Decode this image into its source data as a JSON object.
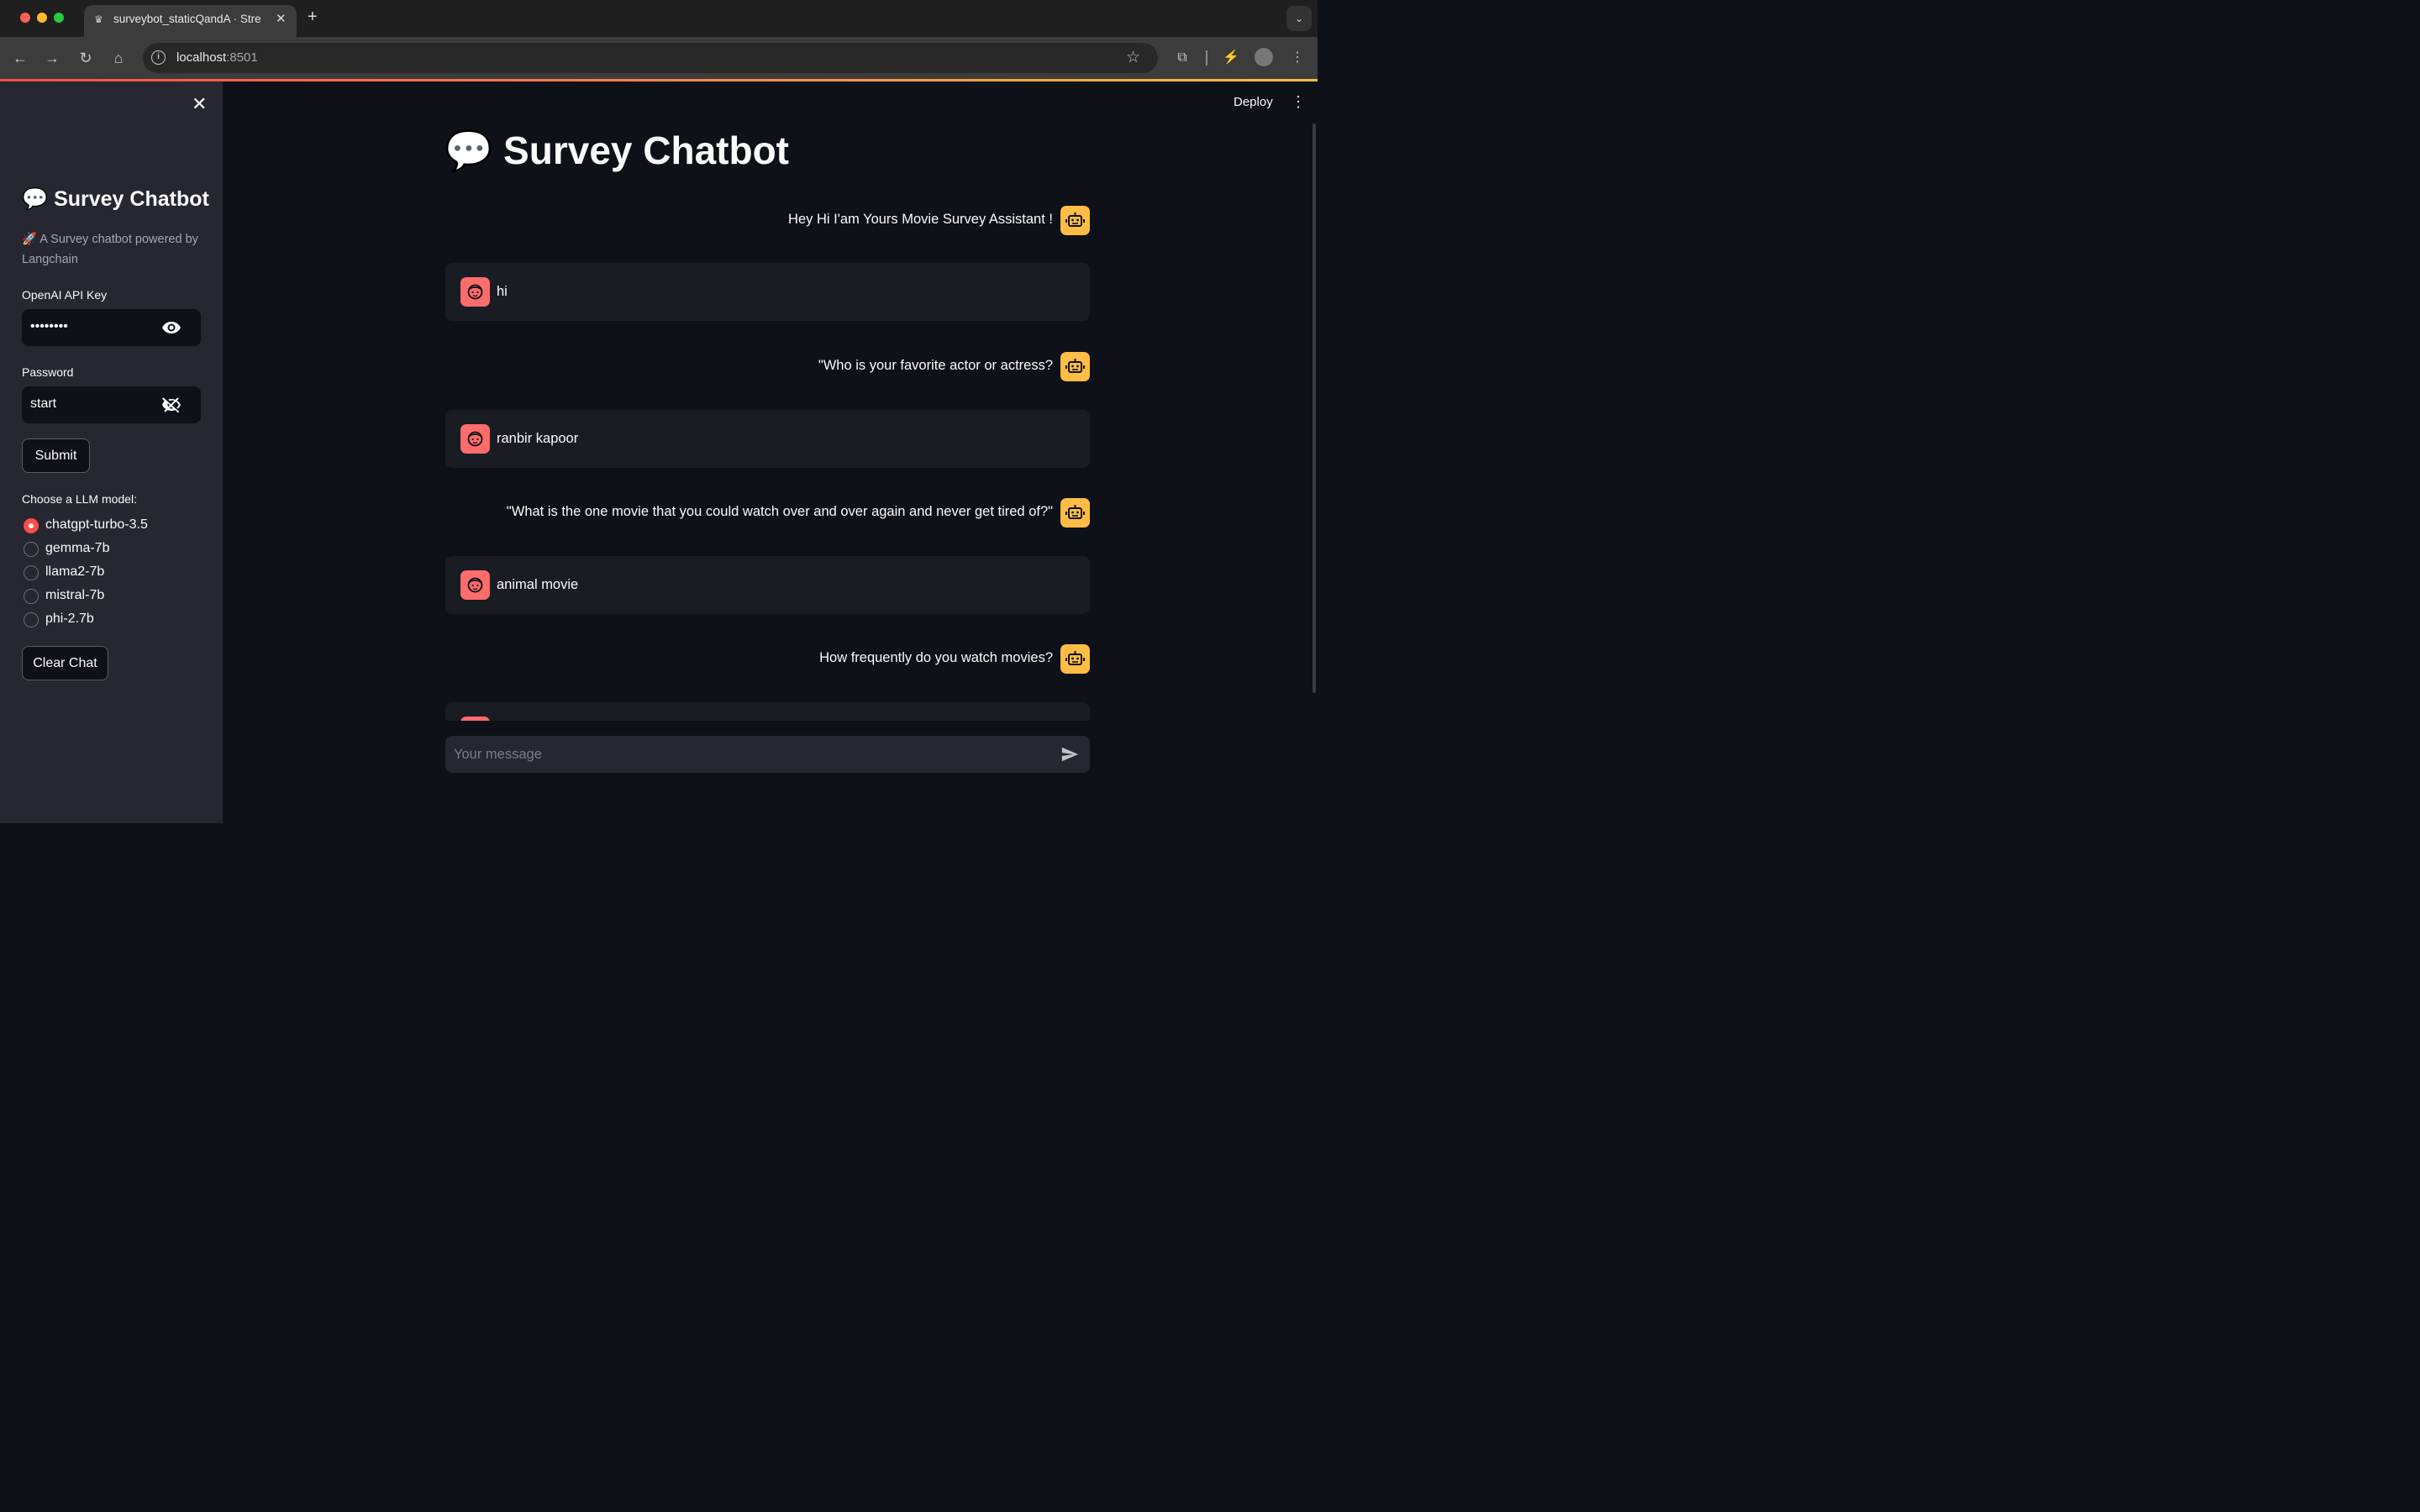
{
  "browser": {
    "tab_title": "surveybot_staticQandA · Stre",
    "url_host": "localhost",
    "url_port": ":8501"
  },
  "sidebar": {
    "title": "💬 Survey Chatbot",
    "subtitle": "🚀 A Survey chatbot powered by Langchain",
    "api_key_label": "OpenAI API Key",
    "api_key_value": "••••••••",
    "password_label": "Password",
    "password_value": "start",
    "submit_label": "Submit",
    "model_label": "Choose a LLM model:",
    "models": [
      {
        "label": "chatgpt-turbo-3.5",
        "selected": true
      },
      {
        "label": "gemma-7b",
        "selected": false
      },
      {
        "label": "llama2-7b",
        "selected": false
      },
      {
        "label": "mistral-7b",
        "selected": false
      },
      {
        "label": "phi-2.7b",
        "selected": false
      }
    ],
    "clear_label": "Clear Chat"
  },
  "header": {
    "deploy_label": "Deploy"
  },
  "main": {
    "title": "💬 Survey Chatbot",
    "messages": [
      {
        "role": "assistant",
        "text": "Hey Hi I'am Yours Movie Survey Assistant !"
      },
      {
        "role": "user",
        "text": "hi"
      },
      {
        "role": "assistant",
        "text": "\"Who is your favorite actor or actress?"
      },
      {
        "role": "user",
        "text": "ranbir kapoor"
      },
      {
        "role": "assistant",
        "text": "\"What is the one movie that you could watch over and over again and never get tired of?\""
      },
      {
        "role": "user",
        "text": "animal movie"
      },
      {
        "role": "assistant",
        "text": "How frequently do you watch movies?"
      },
      {
        "role": "user",
        "text": ""
      }
    ],
    "input_placeholder": "Your message"
  },
  "colors": {
    "accent": "#ff4b4b",
    "assistant_avatar": "#ffbd45",
    "user_avatar": "#ff6c6c",
    "sidebar_bg": "#262730",
    "main_bg": "#0e1117"
  }
}
